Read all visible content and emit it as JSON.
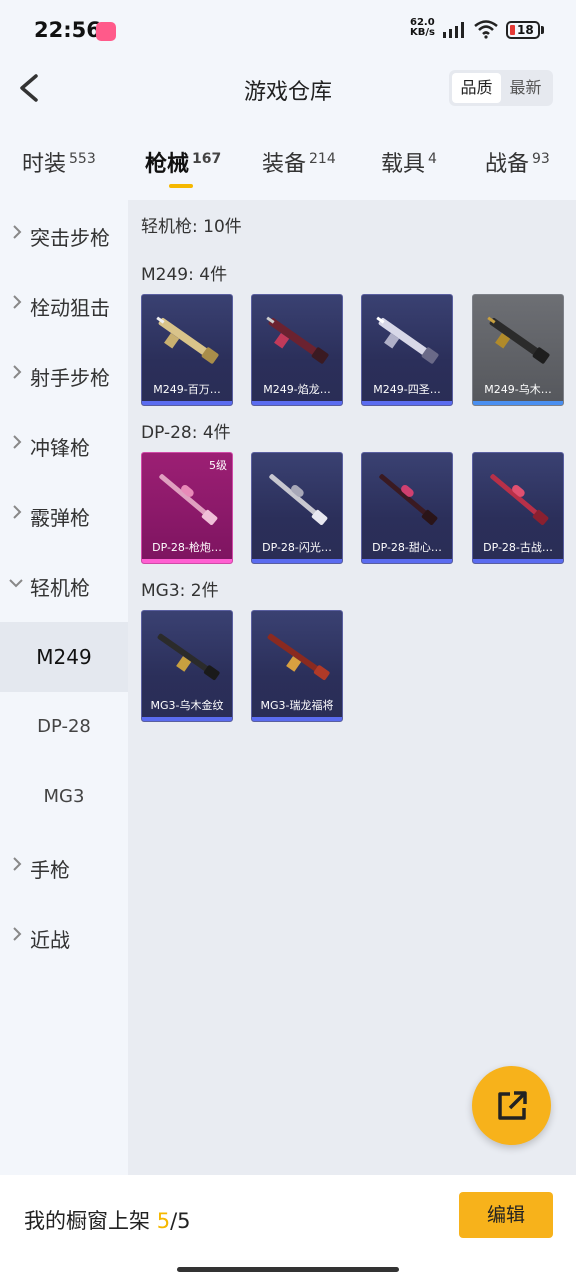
{
  "status": {
    "time": "22:56",
    "net_speed": "62.0",
    "net_unit": "KB/s",
    "battery": "18",
    "colors": {
      "battery_low": "#e53935",
      "app_badge": "#ff5a8a"
    }
  },
  "header": {
    "title": "游戏仓库",
    "sort_options": [
      "品质",
      "最新"
    ],
    "sort_selected": "品质"
  },
  "tabs": [
    {
      "label": "时装",
      "count": "553"
    },
    {
      "label": "枪械",
      "count": "167",
      "active": true
    },
    {
      "label": "装备",
      "count": "214"
    },
    {
      "label": "载具",
      "count": "4"
    },
    {
      "label": "战备",
      "count": "93"
    }
  ],
  "sidebar": {
    "categories": [
      "突击步枪",
      "栓动狙击",
      "射手步枪",
      "冲锋枪",
      "霰弹枪",
      "轻机枪"
    ],
    "sub_items": [
      "M249",
      "DP-28",
      "MG3"
    ],
    "sub_selected": "M249",
    "trailing_categories": [
      "手枪",
      "近战"
    ]
  },
  "content": {
    "summary": "轻机枪: 10件",
    "groups": [
      {
        "title": "M249: 4件",
        "items": [
          {
            "name": "M249-百万…",
            "rarity": "epic"
          },
          {
            "name": "M249-焰龙…",
            "rarity": "epic"
          },
          {
            "name": "M249-四圣…",
            "rarity": "epic"
          },
          {
            "name": "M249-乌木…",
            "rarity": "gray"
          }
        ]
      },
      {
        "title": "DP-28: 4件",
        "items": [
          {
            "name": "DP-28-枪炮…",
            "rarity": "legend",
            "level": "5级"
          },
          {
            "name": "DP-28-闪光…",
            "rarity": "epic"
          },
          {
            "name": "DP-28-甜心…",
            "rarity": "epic"
          },
          {
            "name": "DP-28-古战…",
            "rarity": "epic"
          }
        ]
      },
      {
        "title": "MG3: 2件",
        "items": [
          {
            "name": "MG3-乌木金纹",
            "rarity": "epic"
          },
          {
            "name": "MG3-瑞龙福将",
            "rarity": "epic"
          }
        ]
      }
    ]
  },
  "fab": {
    "icon": "share-icon",
    "color": "#f7b21b"
  },
  "bottom": {
    "label": "我的橱窗上架",
    "shelf_current": "5",
    "shelf_total": "/5",
    "edit_label": "编辑",
    "accent": "#f5b800"
  }
}
